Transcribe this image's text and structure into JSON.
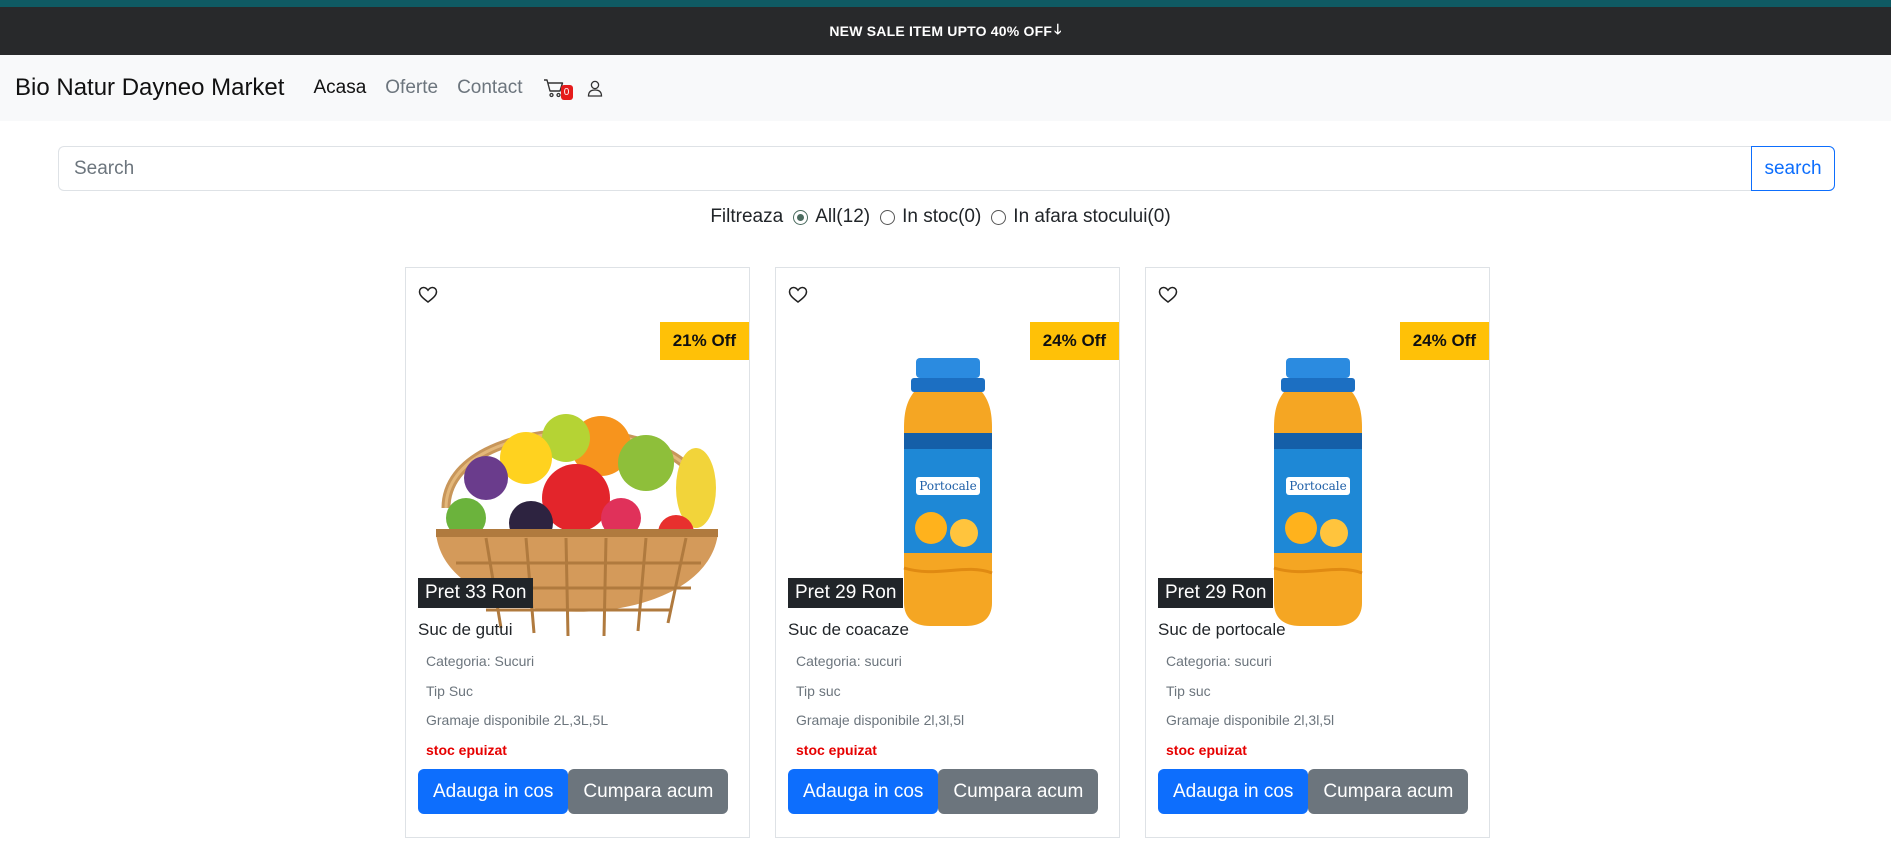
{
  "promo": {
    "text": "NEW SALE ITEM UPTO 40% OFF",
    "arrow": "🡓"
  },
  "nav": {
    "brand": "Bio Natur Dayneo Market",
    "links": [
      "Acasa",
      "Oferte",
      "Contact"
    ],
    "cart_count": "0"
  },
  "search": {
    "placeholder": "Search",
    "value": "",
    "button": "search"
  },
  "filter": {
    "label": "Filtreaza",
    "options": [
      "All(12)",
      "In stoc(0)",
      "In afara stocului(0)"
    ],
    "selected": "All(12)"
  },
  "products": [
    {
      "discount": "21% Off",
      "price": "Pret 33 Ron",
      "name": "Suc de gutui",
      "category": "Categoria: Sucuri",
      "type": "Tip Suc",
      "sizes": "Gramaje disponibile 2L,3L,5L",
      "stock": "stoc epuizat",
      "add_to_cart": "Adauga in cos",
      "buy_now": "Cumpara acum",
      "image": "fruit-basket"
    },
    {
      "discount": "24% Off",
      "price": "Pret 29 Ron",
      "name": "Suc de coacaze",
      "category": "Categoria: sucuri",
      "type": "Tip suc",
      "sizes": "Gramaje disponibile 2l,3l,5l",
      "stock": "stoc epuizat",
      "add_to_cart": "Adauga in cos",
      "buy_now": "Cumpara acum",
      "image": "orange-juice-bottle",
      "bottle_label": "Portocale"
    },
    {
      "discount": "24% Off",
      "price": "Pret 29 Ron",
      "name": "Suc de portocale",
      "category": "Categoria: sucuri",
      "type": "Tip suc",
      "sizes": "Gramaje disponibile 2l,3l,5l",
      "stock": "stoc epuizat",
      "add_to_cart": "Adauga in cos",
      "buy_now": "Cumpara acum",
      "image": "orange-juice-bottle",
      "bottle_label": "Portocale"
    }
  ],
  "colors": {
    "primary": "#0d6efd",
    "secondary": "#6c757d",
    "discount": "#ffc107",
    "stock": "#e60000",
    "promo_bg": "#28292b"
  }
}
